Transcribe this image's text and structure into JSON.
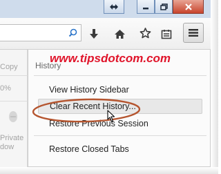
{
  "watermark": "www.tipsdotcom.com",
  "left_panel": {
    "copy_label": "Copy",
    "zoom_value": "0%",
    "private_label": "Private",
    "window_label": "dow"
  },
  "history_menu": {
    "title": "History",
    "items": [
      {
        "label": "View History Sidebar"
      },
      {
        "label": "Clear Recent History..."
      },
      {
        "label": "Restore Previous Session"
      },
      {
        "label": "Restore Closed Tabs"
      }
    ]
  },
  "colors": {
    "watermark": "#e0142a",
    "annotation_oval": "#b5552f"
  }
}
